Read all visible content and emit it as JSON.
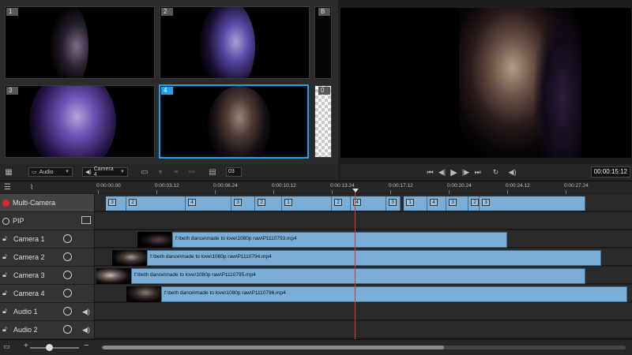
{
  "sources": {
    "cameras": [
      {
        "num": "1"
      },
      {
        "num": "2"
      },
      {
        "num": "3"
      },
      {
        "num": "4"
      }
    ],
    "side_b": "B",
    "side_0": "0",
    "toolbar": {
      "audio_select": "Audio",
      "camera_select": "Camera 4",
      "number_field": "03"
    }
  },
  "preview": {
    "timecode": "00:00:15:12"
  },
  "ruler": {
    "ticks": [
      "0:00:00.00",
      "0:00:03.12",
      "0:00:06.24",
      "0:00:10.12",
      "0:00:13.24",
      "0:00:17.12",
      "0:00:20.24",
      "0:00:24.12",
      "0:00:27.24"
    ]
  },
  "tracks": {
    "multicam": "Multi-Camera",
    "pip": "PIP",
    "camera1": "Camera 1",
    "camera2": "Camera 2",
    "camera3": "Camera 3",
    "camera4": "Camera 4",
    "audio1": "Audio 1",
    "audio2": "Audio 2"
  },
  "multicam_segments": [
    "3",
    "2",
    "4",
    "3",
    "2",
    "1",
    "2",
    "4",
    "3",
    "1",
    "4",
    "3",
    "2",
    "3"
  ],
  "clips": {
    "camera1": "f:\\beth dance\\made to love\\1080p raw\\P1110793.mp4",
    "camera2": "f:\\beth dance\\made to love\\1080p raw\\P1110794.mp4",
    "camera3": "f:\\beth dance\\made to love\\1080p raw\\P1110795.mp4",
    "camera4": "f:\\beth dance\\made to love\\1080p raw\\P1110796.mp4"
  },
  "colors": {
    "accent": "#1fa3e8",
    "clip": "#7aaed6",
    "record": "#e0262a",
    "playhead": "#d23a3a"
  }
}
